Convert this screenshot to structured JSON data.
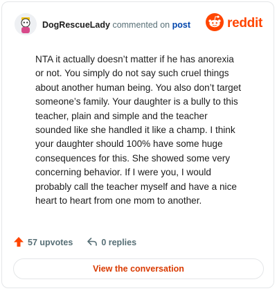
{
  "comment": {
    "username": "DogRescueLady",
    "action_text": "commented on",
    "post_link": "post",
    "body": "NTA it actually doesn’t matter if he has anorexia or not. You simply do not say such cruel things about another human being. You also don’t target someone’s family. Your daughter is a bully to this teacher, plain and simple and the teacher sounded like she handled it like a champ. I think your daughter should 100% have some huge consequences for this. She showed some very concerning behavior. If I were you, I would probably call the teacher myself and have a nice heart to heart from one mom to another.",
    "upvotes_label": "57 upvotes",
    "replies_label": "0 replies"
  },
  "brand": {
    "name": "reddit",
    "color": "#ff4500"
  },
  "cta": {
    "label": "View the conversation"
  },
  "icons": [
    "avatar",
    "reddit-logo-icon",
    "upvote-arrow-icon",
    "reply-icon"
  ]
}
